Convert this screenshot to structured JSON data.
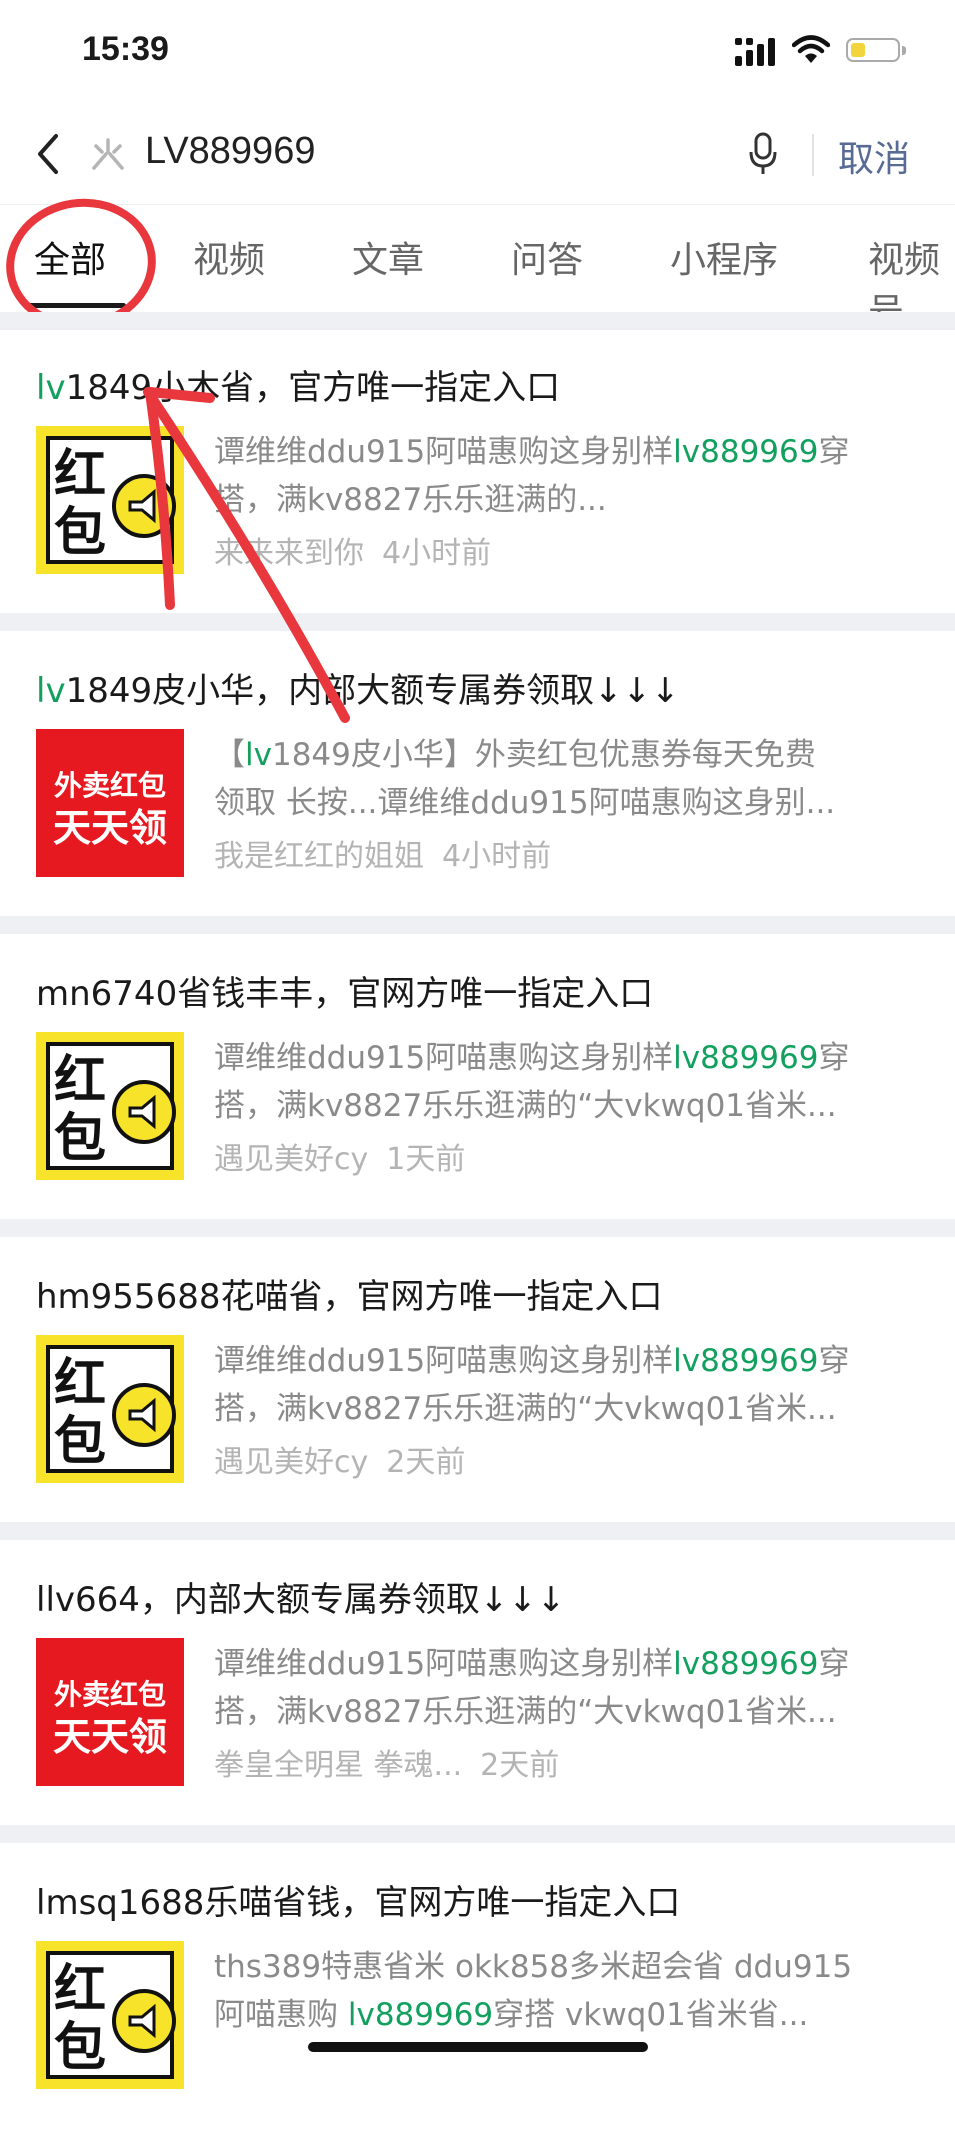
{
  "status": {
    "time": "15:39"
  },
  "search": {
    "query": "LV889969",
    "cancel_label": "取消"
  },
  "tabs": [
    "全部",
    "视频",
    "文章",
    "问答",
    "小程序",
    "视频号"
  ],
  "results": [
    {
      "title_hl": "lv",
      "title_rest": "1849小木省，官方唯一指定入口",
      "line1_pre": "谭维维ddu915阿喵惠购这身别样",
      "line1_hl": "lv889969",
      "line1_post": "穿",
      "line2": "搭，满kv8827乐乐逛满的...",
      "author": "来来来到你",
      "time": "4小时前",
      "thumb": "red-envelope"
    },
    {
      "title_hl": "lv",
      "title_rest": "1849皮小华，内部大额专属券领取↓↓↓",
      "line1_pre": "【",
      "line1_hl": "lv",
      "line1_post": "1849皮小华】外卖红包优惠券每天免费",
      "line2": "领取 长按...谭维维ddu915阿喵惠购这身别...",
      "author": "我是红红的姐姐",
      "time": "4小时前",
      "thumb": "waimai"
    },
    {
      "title_hl": "",
      "title_rest": "mn6740省钱丰丰，官网方唯一指定入口",
      "line1_pre": "谭维维ddu915阿喵惠购这身别样",
      "line1_hl": "lv889969",
      "line1_post": "穿",
      "line2": "搭，满kv8827乐乐逛满的“大vkwq01省米...",
      "author": "遇见美好cy",
      "time": "1天前",
      "thumb": "red-envelope"
    },
    {
      "title_hl": "",
      "title_rest": "hm955688花喵省，官网方唯一指定入口",
      "line1_pre": "谭维维ddu915阿喵惠购这身别样",
      "line1_hl": "lv889969",
      "line1_post": "穿",
      "line2": "搭，满kv8827乐乐逛满的“大vkwq01省米...",
      "author": "遇见美好cy",
      "time": "2天前",
      "thumb": "red-envelope"
    },
    {
      "title_hl": "",
      "title_rest": "llv664，内部大额专属券领取↓↓↓",
      "line1_pre": "谭维维ddu915阿喵惠购这身别样",
      "line1_hl": "lv889969",
      "line1_post": "穿",
      "line2": "搭，满kv8827乐乐逛满的“大vkwq01省米...",
      "author": "拳皇全明星 拳魂...",
      "time": "2天前",
      "thumb": "waimai"
    },
    {
      "title_hl": "",
      "title_rest": "lmsq1688乐喵省钱，官网方唯一指定入口",
      "line1_pre": "ths389特惠省米 okk858多米超会省 ddu915",
      "line1_hl": "",
      "line1_post": "",
      "line2_pre": "阿喵惠购 ",
      "line2_hl": "lv889969",
      "line2_post": "穿搭 vkwq01省米省...",
      "author": "",
      "time": "",
      "thumb": "red-envelope"
    }
  ],
  "thumb_text": {
    "red_envelope_1": "红",
    "red_envelope_2": "包",
    "waimai_1": "外卖红包",
    "waimai_2": "天天领"
  },
  "colors": {
    "highlight": "#13a05f",
    "link": "#576b95",
    "annotation": "#e8383d",
    "thumb_yellow": "#f7e32a",
    "thumb_red": "#e5191f"
  }
}
